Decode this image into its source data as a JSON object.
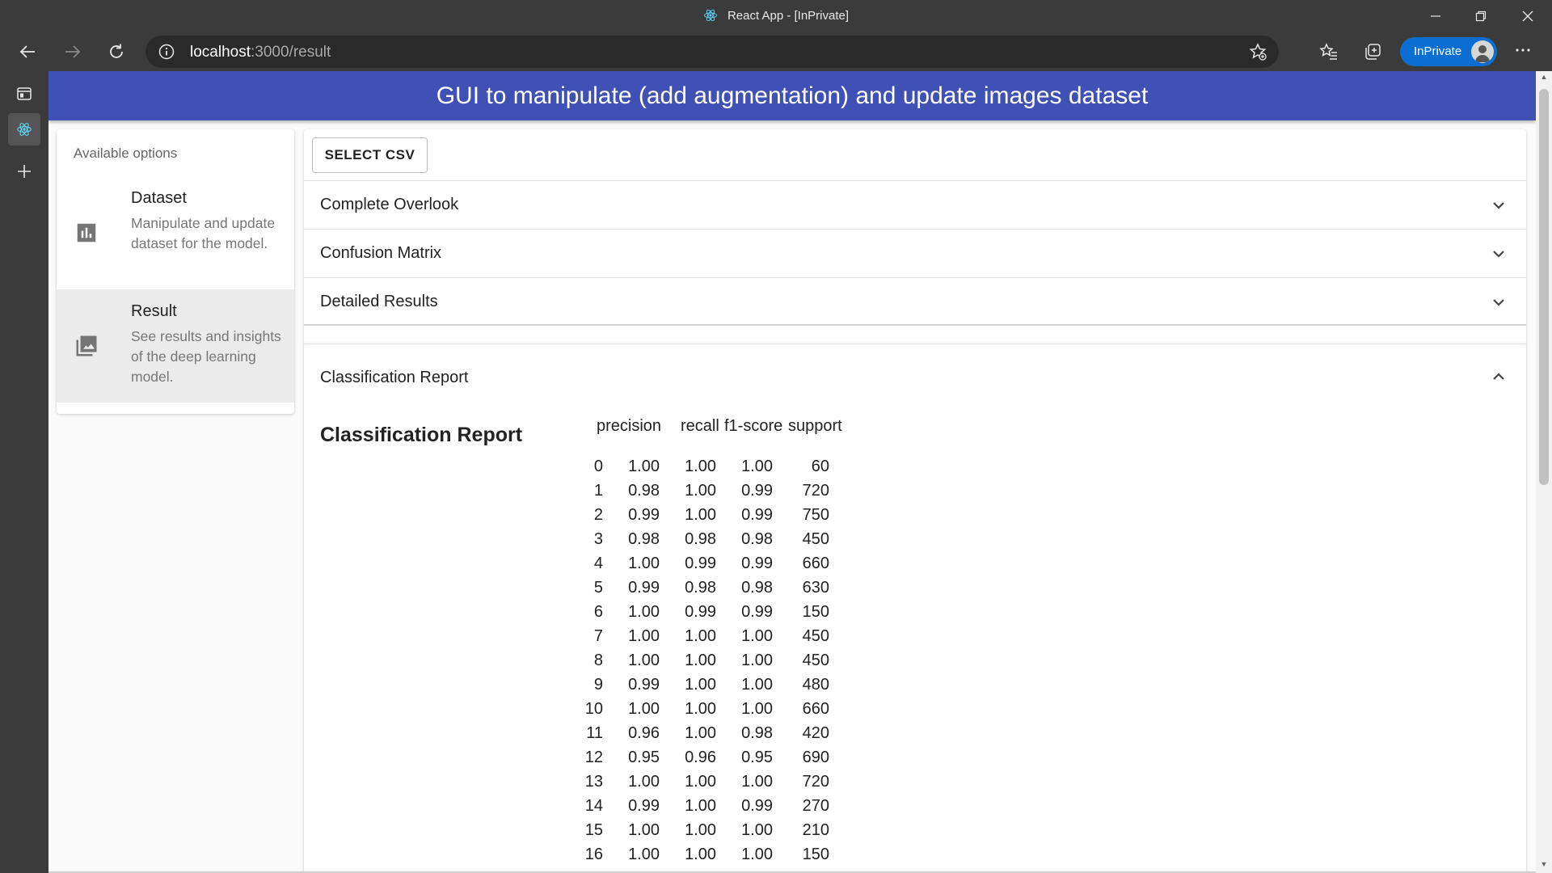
{
  "window": {
    "title": "React App - [InPrivate]"
  },
  "browser": {
    "url_host": "localhost",
    "url_path": ":3000/result",
    "inprivate_label": "InPrivate"
  },
  "app": {
    "header_title": "GUI to manipulate (add augmentation) and update images dataset",
    "options_subheader": "Available options",
    "options": [
      {
        "title": "Dataset",
        "description": "Manipulate and update dataset for the model.",
        "icon": "bar-chart-icon"
      },
      {
        "title": "Result",
        "description": "See results and insights of the deep learning model.",
        "icon": "photo-library-icon"
      }
    ],
    "select_csv_label": "SELECT CSV",
    "accordions": [
      "Complete Overlook",
      "Confusion Matrix",
      "Detailed Results"
    ],
    "open_accordion_title": "Classification Report",
    "report_heading": "Classification Report",
    "report_headers": [
      "precision",
      "recall",
      "f1-score",
      "support"
    ],
    "report_rows": [
      [
        "0",
        "1.00",
        "1.00",
        "1.00",
        "60"
      ],
      [
        "1",
        "0.98",
        "1.00",
        "0.99",
        "720"
      ],
      [
        "2",
        "0.99",
        "1.00",
        "0.99",
        "750"
      ],
      [
        "3",
        "0.98",
        "0.98",
        "0.98",
        "450"
      ],
      [
        "4",
        "1.00",
        "0.99",
        "0.99",
        "660"
      ],
      [
        "5",
        "0.99",
        "0.98",
        "0.98",
        "630"
      ],
      [
        "6",
        "1.00",
        "0.99",
        "0.99",
        "150"
      ],
      [
        "7",
        "1.00",
        "1.00",
        "1.00",
        "450"
      ],
      [
        "8",
        "1.00",
        "1.00",
        "1.00",
        "450"
      ],
      [
        "9",
        "0.99",
        "1.00",
        "1.00",
        "480"
      ],
      [
        "10",
        "1.00",
        "1.00",
        "1.00",
        "660"
      ],
      [
        "11",
        "0.96",
        "1.00",
        "0.98",
        "420"
      ],
      [
        "12",
        "0.95",
        "0.96",
        "0.95",
        "690"
      ],
      [
        "13",
        "1.00",
        "1.00",
        "1.00",
        "720"
      ],
      [
        "14",
        "0.99",
        "1.00",
        "0.99",
        "270"
      ],
      [
        "15",
        "1.00",
        "1.00",
        "1.00",
        "210"
      ],
      [
        "16",
        "1.00",
        "1.00",
        "1.00",
        "150"
      ]
    ]
  }
}
